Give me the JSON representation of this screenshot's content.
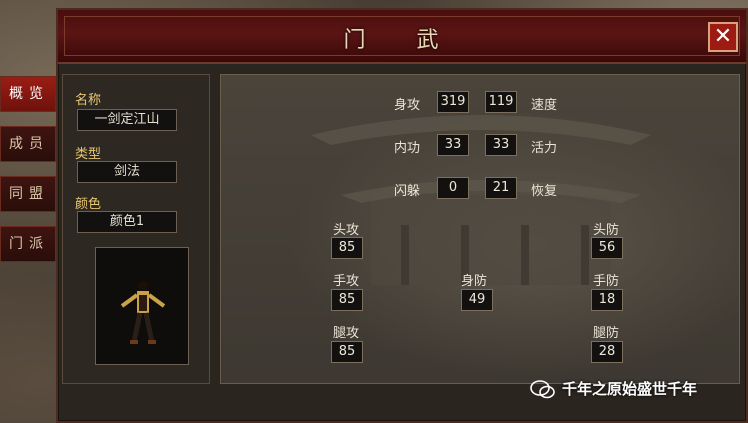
{
  "window": {
    "title": "门 武",
    "close_label": "✕"
  },
  "side_tabs": [
    {
      "label": "概览",
      "active": true
    },
    {
      "label": "成员",
      "active": false
    },
    {
      "label": "同盟",
      "active": false
    },
    {
      "label": "门派",
      "active": false
    }
  ],
  "info": {
    "name_label": "名称",
    "name_value": "一剑定江山",
    "type_label": "类型",
    "type_value": "剑法",
    "color_label": "颜色",
    "color_value": "颜色1"
  },
  "stats": {
    "body_attack": {
      "label": "身攻",
      "value": "319"
    },
    "speed": {
      "label": "速度",
      "value": "119"
    },
    "inner_power": {
      "label": "内功",
      "value": "33"
    },
    "vitality": {
      "label": "活力",
      "value": "33"
    },
    "dodge": {
      "label": "闪躲",
      "value": "0"
    },
    "recovery": {
      "label": "恢复",
      "value": "21"
    },
    "head_attack": {
      "label": "头攻",
      "value": "85"
    },
    "head_defense": {
      "label": "头防",
      "value": "56"
    },
    "hand_attack": {
      "label": "手攻",
      "value": "85"
    },
    "body_defense": {
      "label": "身防",
      "value": "49"
    },
    "hand_defense": {
      "label": "手防",
      "value": "18"
    },
    "leg_attack": {
      "label": "腿攻",
      "value": "85"
    },
    "leg_defense": {
      "label": "腿防",
      "value": "28"
    }
  },
  "watermark": {
    "text": "千年之原始盛世千年"
  },
  "colors": {
    "title_red": "#5a1414",
    "label_gold": "#e8c770",
    "tab_active": "#9b1d15"
  }
}
